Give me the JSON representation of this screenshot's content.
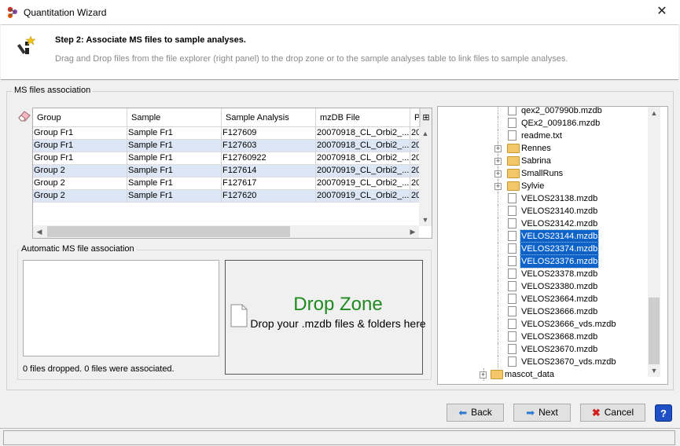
{
  "window": {
    "title": "Quantitation Wizard"
  },
  "header": {
    "step_title": "Step 2: Associate MS files to sample analyses.",
    "description": "Drag and Drop files from the file explorer (right panel) to the drop zone or to the sample analyses table to link files to sample analyses."
  },
  "association": {
    "group_title": "MS files association",
    "columns": [
      "Group",
      "Sample",
      "Sample Analysis",
      "mzDB File",
      "P"
    ],
    "rows": [
      [
        "Group Fr1",
        "Sample Fr1",
        "F127609",
        "20070918_CL_Orbi2_...",
        "20"
      ],
      [
        "Group Fr1",
        "Sample Fr1",
        "F127603",
        "20070918_CL_Orbi2_...",
        "20"
      ],
      [
        "Group Fr1",
        "Sample Fr1",
        "F12760922",
        "20070918_CL_Orbi2_...",
        "20"
      ],
      [
        "Group 2",
        "Sample Fr1",
        "F127614",
        "20070919_CL_Orbi2_...",
        "20"
      ],
      [
        "Group 2",
        "Sample Fr1",
        "F127617",
        "20070919_CL_Orbi2_...",
        "20"
      ],
      [
        "Group 2",
        "Sample Fr1",
        "F127620",
        "20070919_CL_Orbi2_...",
        "20"
      ]
    ]
  },
  "auto": {
    "title": "Automatic MS file association",
    "status": "0 files dropped. 0 files were associated."
  },
  "dropzone": {
    "title": "Drop Zone",
    "subtitle": "Drop your .mzdb files & folders here"
  },
  "tree": {
    "nodes": [
      {
        "label": "qex2_007990b.mzdb",
        "type": "file",
        "selected": false
      },
      {
        "label": "QEx2_009186.mzdb",
        "type": "file",
        "selected": false
      },
      {
        "label": "readme.txt",
        "type": "file",
        "selected": false
      },
      {
        "label": "Rennes",
        "type": "folder",
        "selected": false
      },
      {
        "label": "Sabrina",
        "type": "folder",
        "selected": false
      },
      {
        "label": "SmallRuns",
        "type": "folder",
        "selected": false
      },
      {
        "label": "Sylvie",
        "type": "folder",
        "selected": false
      },
      {
        "label": "VELOS23138.mzdb",
        "type": "file",
        "selected": false
      },
      {
        "label": "VELOS23140.mzdb",
        "type": "file",
        "selected": false
      },
      {
        "label": "VELOS23142.mzdb",
        "type": "file",
        "selected": false
      },
      {
        "label": "VELOS23144.mzdb",
        "type": "file",
        "selected": true
      },
      {
        "label": "VELOS23374.mzdb",
        "type": "file",
        "selected": true
      },
      {
        "label": "VELOS23376.mzdb",
        "type": "file",
        "selected": true
      },
      {
        "label": "VELOS23378.mzdb",
        "type": "file",
        "selected": false
      },
      {
        "label": "VELOS23380.mzdb",
        "type": "file",
        "selected": false
      },
      {
        "label": "VELOS23664.mzdb",
        "type": "file",
        "selected": false
      },
      {
        "label": "VELOS23666.mzdb",
        "type": "file",
        "selected": false
      },
      {
        "label": "VELOS23666_vds.mzdb",
        "type": "file",
        "selected": false
      },
      {
        "label": "VELOS23668.mzdb",
        "type": "file",
        "selected": false
      },
      {
        "label": "VELOS23670.mzdb",
        "type": "file",
        "selected": false
      },
      {
        "label": "VELOS23670_vds.mzdb",
        "type": "file",
        "selected": false
      },
      {
        "label": "mascot_data",
        "type": "folder",
        "selected": false
      }
    ]
  },
  "buttons": {
    "back": "Back",
    "next": "Next",
    "cancel": "Cancel",
    "help": "?"
  },
  "colors": {
    "dropzone_title": "#1f8a1f",
    "selection": "#0e63c8",
    "alt_row": "#dce6f4"
  }
}
